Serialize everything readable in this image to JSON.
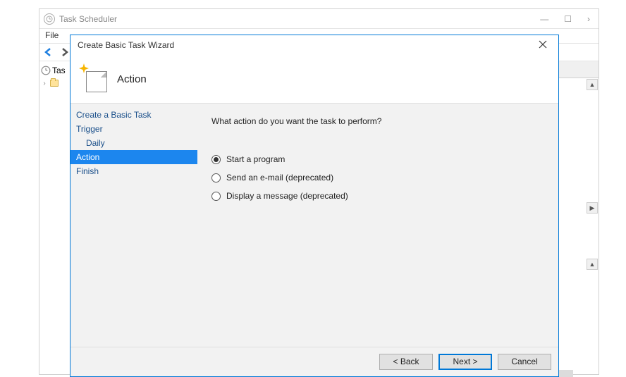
{
  "bg": {
    "title": "Task Scheduler",
    "menu_file": "File",
    "tree": {
      "root_label": "Tas",
      "child_label": ""
    },
    "controls": {
      "min": "—",
      "max": "☐",
      "close": "›"
    }
  },
  "wizard": {
    "title": "Create Basic Task Wizard",
    "heading": "Action",
    "nav": {
      "items": [
        {
          "label": "Create a Basic Task",
          "indent": false,
          "selected": false
        },
        {
          "label": "Trigger",
          "indent": false,
          "selected": false
        },
        {
          "label": "Daily",
          "indent": true,
          "selected": false
        },
        {
          "label": "Action",
          "indent": false,
          "selected": true
        },
        {
          "label": "Finish",
          "indent": false,
          "selected": false
        }
      ]
    },
    "question": "What action do you want the task to perform?",
    "options": [
      {
        "label": "Start a program",
        "checked": true
      },
      {
        "label": "Send an e-mail (deprecated)",
        "checked": false
      },
      {
        "label": "Display a message (deprecated)",
        "checked": false
      }
    ],
    "buttons": {
      "back": "< Back",
      "next": "Next >",
      "cancel": "Cancel"
    }
  }
}
